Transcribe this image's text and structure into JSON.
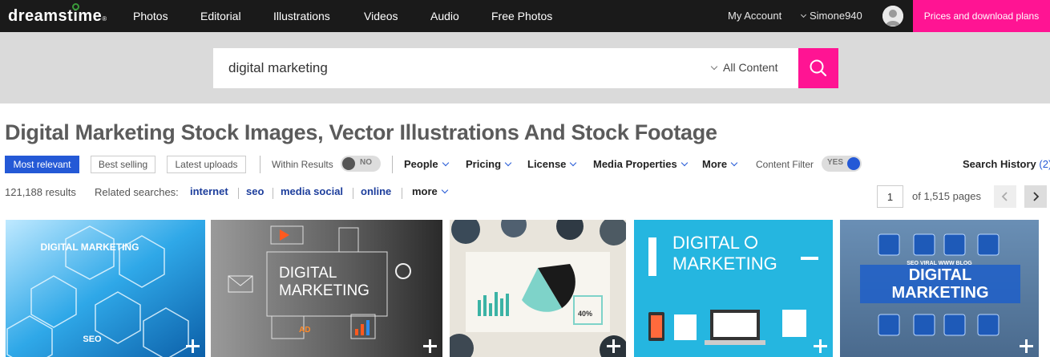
{
  "brand": {
    "logo_text": "dreamstime",
    "logo_mark": "®"
  },
  "nav": {
    "items": [
      "Photos",
      "Editorial",
      "Illustrations",
      "Videos",
      "Audio",
      "Free Photos"
    ],
    "account": "My Account",
    "username": "Simone940",
    "plans_button": "Prices and download plans"
  },
  "search": {
    "value": "digital marketing",
    "content_select": "All Content"
  },
  "page": {
    "title": "Digital Marketing Stock Images, Vector Illustrations And Stock Footage"
  },
  "filters": {
    "sort_buttons": [
      "Most relevant",
      "Best selling",
      "Latest uploads"
    ],
    "active_sort": "Most relevant",
    "within_results_label": "Within Results",
    "within_results_state": "NO",
    "menus": [
      "People",
      "Pricing",
      "License",
      "Media Properties",
      "More"
    ],
    "content_filter_label": "Content Filter",
    "content_filter_state": "YES",
    "search_history_label": "Search History",
    "search_history_count": "(2)"
  },
  "results": {
    "count_text": "121,188 results",
    "related_label": "Related searches:",
    "related": [
      "internet",
      "seo",
      "media social",
      "online"
    ],
    "more_label": "more"
  },
  "pagination": {
    "current_page": "1",
    "total_text": "of 1,515 pages"
  },
  "thumbnails": [
    {
      "overlay_text": "DIGITAL MARKETING",
      "extra_text": "SEO"
    },
    {
      "overlay_text": "DIGITAL MARKETING",
      "extra_text": "AD"
    },
    {
      "overlay_text": "",
      "extra_text": "40%"
    },
    {
      "overlay_text": "DIGITAL MARKETING",
      "extra_text": ""
    },
    {
      "overlay_text": "DIGITAL MARKETING",
      "extra_text": "SEO VIRAL WWW BLOG"
    }
  ],
  "colors": {
    "nav_bg": "#1a1a1a",
    "accent_pink": "#ff1493",
    "primary_blue": "#2459d6",
    "link_blue": "#1d3e9c"
  },
  "icons": [
    "search-icon",
    "chevron-down-icon",
    "chevron-left-icon",
    "chevron-right-icon",
    "user-avatar-icon",
    "add-to-lightbox-icon"
  ]
}
